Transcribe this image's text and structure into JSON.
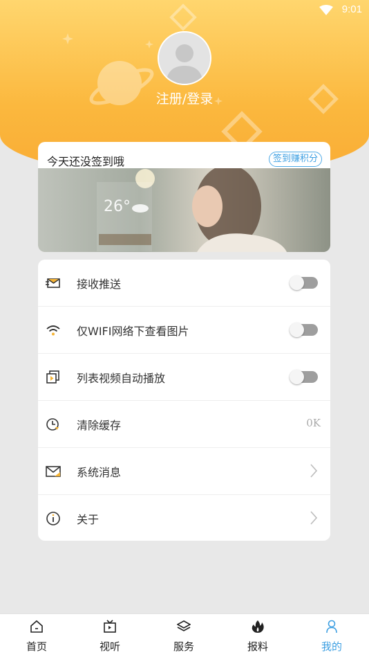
{
  "status_bar": {
    "time": "9:01"
  },
  "header": {
    "login_text": "注册/登录"
  },
  "sign_card": {
    "title": "今天还没签到哦",
    "badge": "签到赚积分"
  },
  "settings": {
    "items": [
      {
        "label": "接收推送",
        "icon": "envelope-fly-icon",
        "control": "toggle",
        "toggle_on": false
      },
      {
        "label": "仅WIFI网络下查看图片",
        "icon": "wifi-icon",
        "control": "toggle",
        "toggle_on": false
      },
      {
        "label": "列表视频自动播放",
        "icon": "video-copy-icon",
        "control": "toggle",
        "toggle_on": false
      },
      {
        "label": "清除缓存",
        "icon": "clock-icon",
        "control": "value",
        "value": "0K"
      },
      {
        "label": "系统消息",
        "icon": "mail-icon",
        "control": "chevron"
      },
      {
        "label": "关于",
        "icon": "info-icon",
        "control": "chevron"
      }
    ]
  },
  "tabbar": {
    "items": [
      {
        "label": "首页",
        "icon": "home-icon",
        "active": false
      },
      {
        "label": "视听",
        "icon": "tv-icon",
        "active": false
      },
      {
        "label": "服务",
        "icon": "layers-icon",
        "active": false
      },
      {
        "label": "报料",
        "icon": "flame-icon",
        "active": false
      },
      {
        "label": "我的",
        "icon": "user-icon",
        "active": true
      }
    ]
  },
  "colors": {
    "accent": "#3d9fe2",
    "header_top": "#ffd66e",
    "header_bottom": "#f9ac35"
  }
}
